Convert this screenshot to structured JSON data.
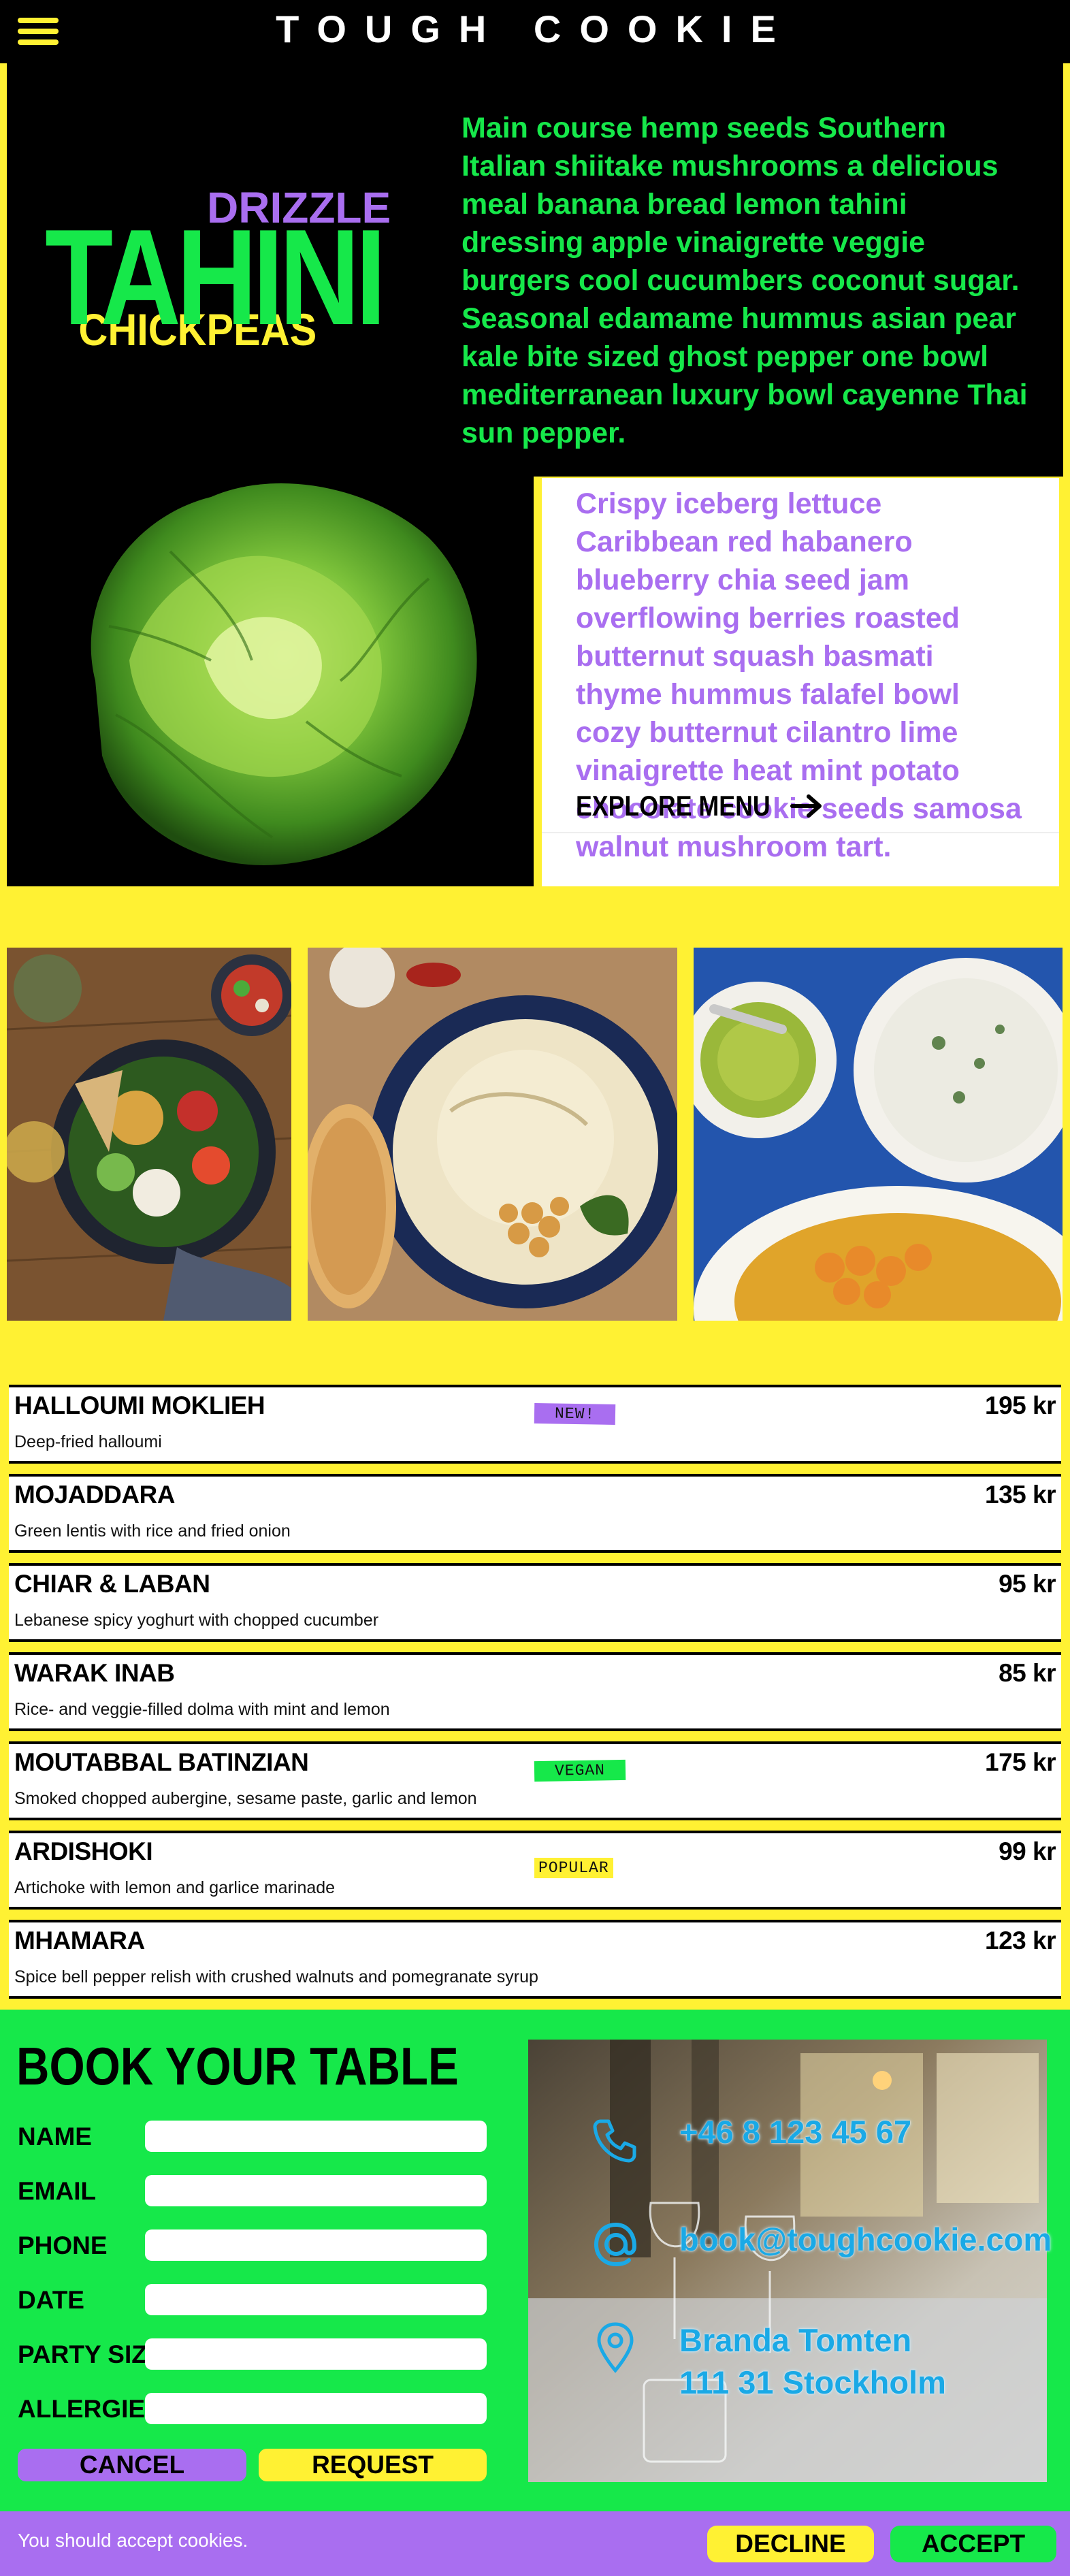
{
  "header": {
    "title": "TOUGH COOKIE",
    "menu_icon": "hamburger-icon"
  },
  "hero": {
    "drizzle": "DRIZZLE",
    "tahini": "TAHINI",
    "chickpeas": "CHICKPEAS",
    "text": "Main course hemp seeds Southern Italian shiitake mushrooms a delicious meal banana bread lemon tahini dressing apple vinaigrette veggie burgers cool cucumbers coconut sugar. Seasonal edamame hummus asian pear kale bite sized ghost pepper one bowl mediterranean luxury bowl cayenne Thai sun pepper."
  },
  "card": {
    "text": "Crispy iceberg lettuce Caribbean red habanero blueberry chia seed jam overflowing berries roasted butternut squash basmati thyme hummus falafel bowl cozy butternut cilantro lime vinaigrette heat mint potato chocolate cookie seeds samosa walnut mushroom tart.",
    "cta": "EXPLORE MENU",
    "cta_icon": "arrow-right-icon"
  },
  "menu": [
    {
      "name": "HALLOUMI MOKLIEH",
      "desc": "Deep-fried halloumi",
      "price": "195 kr",
      "badge": "NEW!",
      "badge_color": "#a96ef0"
    },
    {
      "name": "MOJADDARA",
      "desc": "Green lentis with rice and fried onion",
      "price": "135 kr",
      "badge": "",
      "badge_color": ""
    },
    {
      "name": "CHIAR & LABAN",
      "desc": "Lebanese spicy yoghurt with chopped cucumber",
      "price": "95 kr",
      "badge": "",
      "badge_color": ""
    },
    {
      "name": "WARAK INAB",
      "desc": "Rice- and veggie-filled dolma with mint and lemon",
      "price": "85 kr",
      "badge": "",
      "badge_color": ""
    },
    {
      "name": "MOUTABBAL BATINZIAN",
      "desc": "Smoked chopped aubergine, sesame paste, garlic and lemon",
      "price": "175 kr",
      "badge": "VEGAN",
      "badge_color": "#16e84a"
    },
    {
      "name": "ARDISHOKI",
      "desc": "Artichoke with lemon and garlice marinade",
      "price": "99 kr",
      "badge": "POPULAR",
      "badge_color": "#fff133"
    },
    {
      "name": "MHAMARA",
      "desc": "Spice bell pepper relish with crushed walnuts and pomegranate syrup",
      "price": "123 kr",
      "badge": "",
      "badge_color": ""
    }
  ],
  "booking": {
    "title": "BOOK YOUR TABLE",
    "fields": [
      "NAME",
      "EMAIL",
      "PHONE",
      "DATE",
      "PARTY SIZE",
      "ALLERGIES"
    ],
    "cancel": "CANCEL",
    "request": "REQUEST"
  },
  "contact": {
    "phone": "+46 8 123 45 67",
    "email": "book@toughcookie.com",
    "address_line1": "Branda Tomten",
    "address_line2": "111 31 Stockholm",
    "phone_icon": "phone-icon",
    "email_icon": "at-icon",
    "address_icon": "map-pin-icon"
  },
  "cookies": {
    "text": "You should accept cookies.",
    "decline": "DECLINE",
    "accept": "ACCEPT"
  },
  "colors": {
    "yellow": "#fff133",
    "green": "#16e84a",
    "purple": "#a96ef0",
    "black": "#000000",
    "blue": "#1aa9e6"
  }
}
